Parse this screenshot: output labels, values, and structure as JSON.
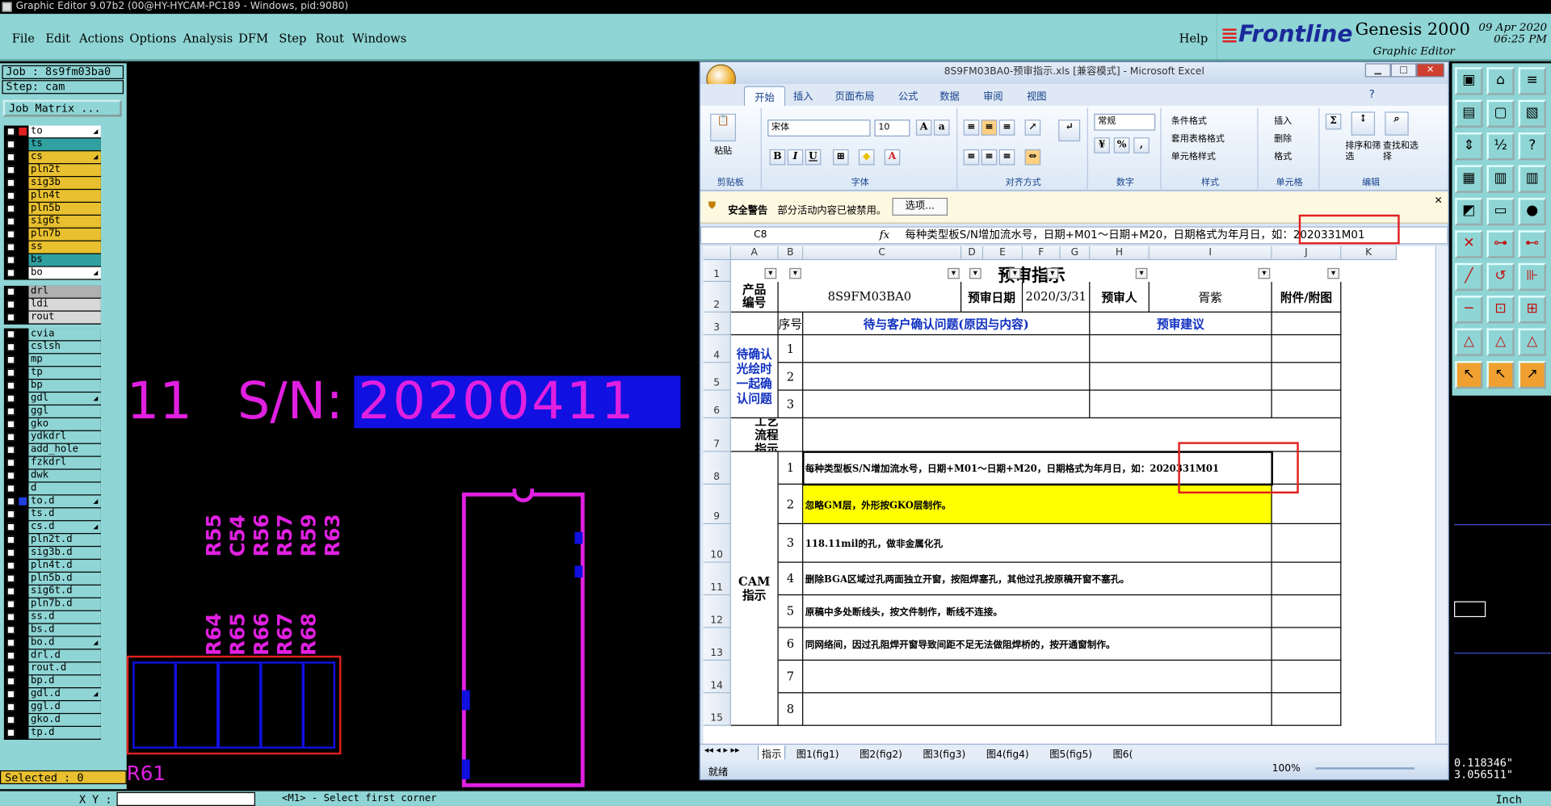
{
  "title": "Graphic Editor 9.07b2 (00@HY-HYCAM-PC189 - Windows, pid:9080)",
  "menu": [
    "File",
    "Edit",
    "Actions",
    "Options",
    "Analysis",
    "DFM",
    "Step",
    "Rout",
    "Windows"
  ],
  "help": "Help",
  "brand": {
    "frontline": "Frontline",
    "genesis": "Genesis 2000",
    "ge": "Graphic Editor",
    "date": "09 Apr 2020",
    "time": "06:25 PM"
  },
  "job": "Job : 8s9fm03ba0",
  "step": "Step: cam",
  "job_matrix": "Job Matrix ...",
  "layers1": [
    {
      "n": "to",
      "c": "#ffffff",
      "a": true,
      "red": true
    },
    {
      "n": "ts",
      "c": "#30a0a0"
    },
    {
      "n": "cs",
      "c": "#e8c030",
      "a": true
    },
    {
      "n": "pln2t",
      "c": "#e8c030"
    },
    {
      "n": "sig3b",
      "c": "#e8c030"
    },
    {
      "n": "pln4t",
      "c": "#e8c030"
    },
    {
      "n": "pln5b",
      "c": "#e8c030"
    },
    {
      "n": "sig6t",
      "c": "#e8c030"
    },
    {
      "n": "pln7b",
      "c": "#e8c030"
    },
    {
      "n": "ss",
      "c": "#e8c030"
    },
    {
      "n": "bs",
      "c": "#30a0a0"
    },
    {
      "n": "bo",
      "c": "#ffffff",
      "a": true
    }
  ],
  "layers2": [
    {
      "n": "drl",
      "c": "#b0b0b0"
    },
    {
      "n": "ldi",
      "c": "#d8d8d8"
    },
    {
      "n": "rout",
      "c": "#d8d8d8"
    }
  ],
  "layers3": [
    {
      "n": "cvia"
    },
    {
      "n": "cslsh"
    },
    {
      "n": "mp"
    },
    {
      "n": "tp"
    },
    {
      "n": "bp"
    },
    {
      "n": "gdl",
      "a": true
    },
    {
      "n": "ggl"
    },
    {
      "n": "gko"
    },
    {
      "n": "ydkdrl"
    },
    {
      "n": "add_hole"
    },
    {
      "n": "fzkdrl"
    },
    {
      "n": "dwk"
    },
    {
      "n": "d"
    },
    {
      "n": "to.d",
      "a": true,
      "blue": true
    },
    {
      "n": "ts.d"
    },
    {
      "n": "cs.d",
      "a": true
    },
    {
      "n": "pln2t.d"
    },
    {
      "n": "sig3b.d"
    },
    {
      "n": "pln4t.d"
    },
    {
      "n": "pln5b.d"
    },
    {
      "n": "sig6t.d"
    },
    {
      "n": "pln7b.d"
    },
    {
      "n": "ss.d"
    },
    {
      "n": "bs.d"
    },
    {
      "n": "bo.d",
      "a": true
    },
    {
      "n": "drl.d"
    },
    {
      "n": "rout.d"
    },
    {
      "n": "bp.d"
    },
    {
      "n": "gdl.d",
      "a": true
    },
    {
      "n": "ggl.d"
    },
    {
      "n": "gko.d"
    },
    {
      "n": "tp.d"
    }
  ],
  "selected": "Selected : 0",
  "xy_label": "X Y :",
  "status_msg": "<M1> - Select first corner",
  "units": "Inch",
  "coords": [
    "0.118346\"",
    "3.056511\""
  ],
  "canvas": {
    "sn_left": "11",
    "sn": "S/N:",
    "sn_val": "20200411",
    "refs_top": [
      "R55",
      "C54",
      "R56",
      "R57",
      "R59",
      "R63"
    ],
    "refs_bot": [
      "R64",
      "R65",
      "R66",
      "R67",
      "R68"
    ],
    "r61": "R61"
  },
  "excel": {
    "title": "8S9FM03BA0-预审指示.xls [兼容模式] - Microsoft Excel",
    "tabs": [
      "开始",
      "插入",
      "页面布局",
      "公式",
      "数据",
      "审阅",
      "视图"
    ],
    "groups": [
      "剪贴板",
      "字体",
      "对齐方式",
      "数字",
      "样式",
      "单元格",
      "编辑"
    ],
    "paste": "粘贴",
    "font": "宋体",
    "size": "10",
    "numfmt": "常规",
    "styles": [
      "条件格式",
      "套用表格格式",
      "单元格样式"
    ],
    "cells_btn": [
      "插入",
      "删除",
      "格式"
    ],
    "edit_btn": [
      "排序和筛选",
      "查找和选择"
    ],
    "security": "安全警告",
    "security_msg": "部分活动内容已被禁用。",
    "options": "选项...",
    "namebox": "C8",
    "fx": "fx",
    "formula": "每种类型板S/N增加流水号，日期+M01～日期+M20，日期格式为年月日，如：2020331M01",
    "cols": [
      "A",
      "B",
      "C",
      "D",
      "E",
      "F",
      "G",
      "H",
      "I",
      "J",
      "K"
    ],
    "rows": [
      "1",
      "2",
      "3",
      "4",
      "5",
      "6",
      "7",
      "8",
      "9",
      "10",
      "11",
      "12",
      "13",
      "14",
      "15"
    ],
    "sheet_title": "预审指示",
    "product_label": "产品编号",
    "product": "8S9FM03BA0",
    "date_label": "预审日期",
    "date": "2020/3/31",
    "reviewer_label": "预审人",
    "reviewer": "胥紫",
    "attach_label": "附件/附图",
    "seq_label": "序号",
    "issue_header": "待与客户确认问题(原因与内容)",
    "suggest_header": "预审建议",
    "confirm_label": "待确认光绘时一起确认问题",
    "process_label": "工艺流程指示",
    "cam_label": "CAM指示",
    "seq": [
      "1",
      "2",
      "3"
    ],
    "cam_seq": [
      "1",
      "2",
      "3",
      "4",
      "5",
      "6",
      "7",
      "8"
    ],
    "cam_items": [
      "每种类型板S/N增加流水号，日期+M01～日期+M20，日期格式为年月日，如：2020331M01",
      "忽略GM层，外形按GKO层制作。",
      "118.11mil的孔，做非金属化孔",
      "删除BGA区域过孔两面独立开窗，按阻焊塞孔，其他过孔按原稿开窗不塞孔。",
      "原稿中多处断线头，按文件制作，断线不连接。",
      "同网络间，因过孔阻焊开窗导致间距不足无法做阻焊桥的，按开通窗制作。",
      "",
      ""
    ],
    "sheet_tabs": [
      "指示",
      "图1(fig1)",
      "图2(fig2)",
      "图3(fig3)",
      "图4(fig4)",
      "图5(fig5)",
      "图6("
    ],
    "status": "就绪",
    "zoom": "100%"
  },
  "colors": {
    "magenta": "#e020e0",
    "highlight": "#ffff00",
    "panel": "#8fd5d5",
    "redbox": "#e02020"
  }
}
